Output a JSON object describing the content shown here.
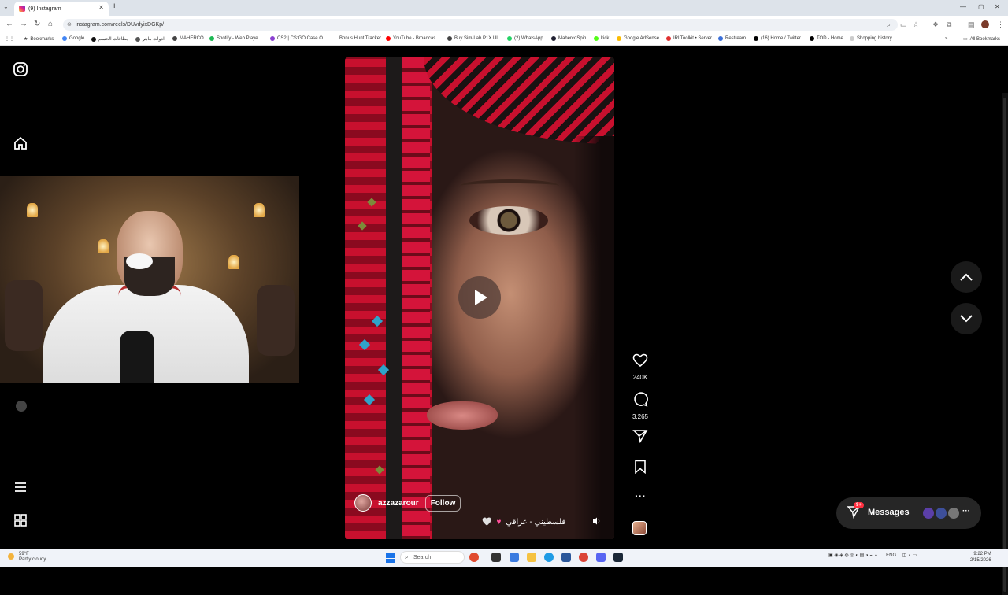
{
  "browser": {
    "tab_title": "(9) Instagram",
    "url": "instagram.com/reels/DUvdyixDGKp/",
    "bookmarks": [
      "Bookmarks",
      "Google",
      "بطاقات الحسم",
      "ادوات ماهر",
      "MAHERCO",
      "Spotify - Web Playe...",
      "CS2 | CS:GO Case O...",
      "Bonus Hunt Tracker",
      "YouTube - Broadcas...",
      "Buy Sim-Lab P1X Ul...",
      "(2) WhatsApp",
      "MahercoSpin",
      "kick",
      "Google AdSense",
      "IRLToolkit • Server",
      "Restream",
      "(16) Home / Twitter",
      "TOD - Home",
      "Shopping history"
    ],
    "all_bookmarks": "All Bookmarks"
  },
  "reel": {
    "author": "azzazarour",
    "follow_label": "Follow",
    "caption": "فلسطيني - عراقي",
    "likes": "240K",
    "comments": "3,265"
  },
  "messages": {
    "label": "Messages",
    "badge": "9+"
  },
  "taskbar": {
    "weather_temp": "59°F",
    "weather_desc": "Partly cloudy",
    "search_placeholder": "Search",
    "lang": "ENG",
    "time": "9:22 PM",
    "date": "2/15/2026"
  },
  "icons": {
    "instagram": "instagram-icon",
    "home": "home-icon",
    "menu": "hamburger-icon",
    "more": "grid-icon",
    "like": "heart-icon",
    "comment": "comment-icon",
    "share": "send-icon",
    "save": "bookmark-icon",
    "options": "ellipsis-icon"
  },
  "colors": {
    "accent": "#ff3040",
    "page_bg": "#000000"
  }
}
